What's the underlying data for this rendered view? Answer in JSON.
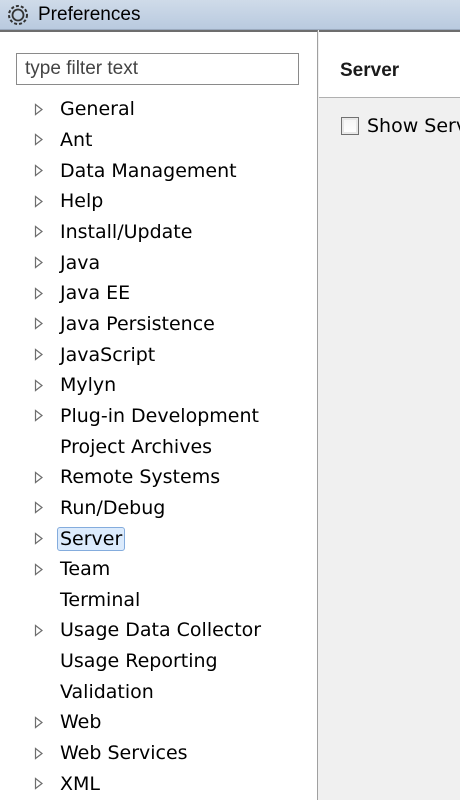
{
  "window": {
    "title": "Preferences"
  },
  "filter": {
    "placeholder": "type filter text"
  },
  "tree": [
    {
      "label": "General",
      "expandable": true
    },
    {
      "label": "Ant",
      "expandable": true
    },
    {
      "label": "Data Management",
      "expandable": true
    },
    {
      "label": "Help",
      "expandable": true
    },
    {
      "label": "Install/Update",
      "expandable": true
    },
    {
      "label": "Java",
      "expandable": true
    },
    {
      "label": "Java EE",
      "expandable": true
    },
    {
      "label": "Java Persistence",
      "expandable": true
    },
    {
      "label": "JavaScript",
      "expandable": true
    },
    {
      "label": "Mylyn",
      "expandable": true
    },
    {
      "label": "Plug-in Development",
      "expandable": true
    },
    {
      "label": "Project Archives",
      "expandable": false
    },
    {
      "label": "Remote Systems",
      "expandable": true
    },
    {
      "label": "Run/Debug",
      "expandable": true
    },
    {
      "label": "Server",
      "expandable": true,
      "selected": true
    },
    {
      "label": "Team",
      "expandable": true
    },
    {
      "label": "Terminal",
      "expandable": false
    },
    {
      "label": "Usage Data Collector",
      "expandable": true
    },
    {
      "label": "Usage Reporting",
      "expandable": false
    },
    {
      "label": "Validation",
      "expandable": false
    },
    {
      "label": "Web",
      "expandable": true
    },
    {
      "label": "Web Services",
      "expandable": true
    },
    {
      "label": "XML",
      "expandable": true
    }
  ],
  "page": {
    "title": "Server",
    "show_checkbox_label": "Show Serv",
    "show_checkbox_checked": false
  },
  "icons": {
    "app": "eclipse-gear-icon",
    "expander": "triangle-right-icon"
  },
  "colors": {
    "selection_bg": "#dcebfc",
    "selection_border": "#84acdd",
    "titlebar": "#c4d3e6"
  }
}
